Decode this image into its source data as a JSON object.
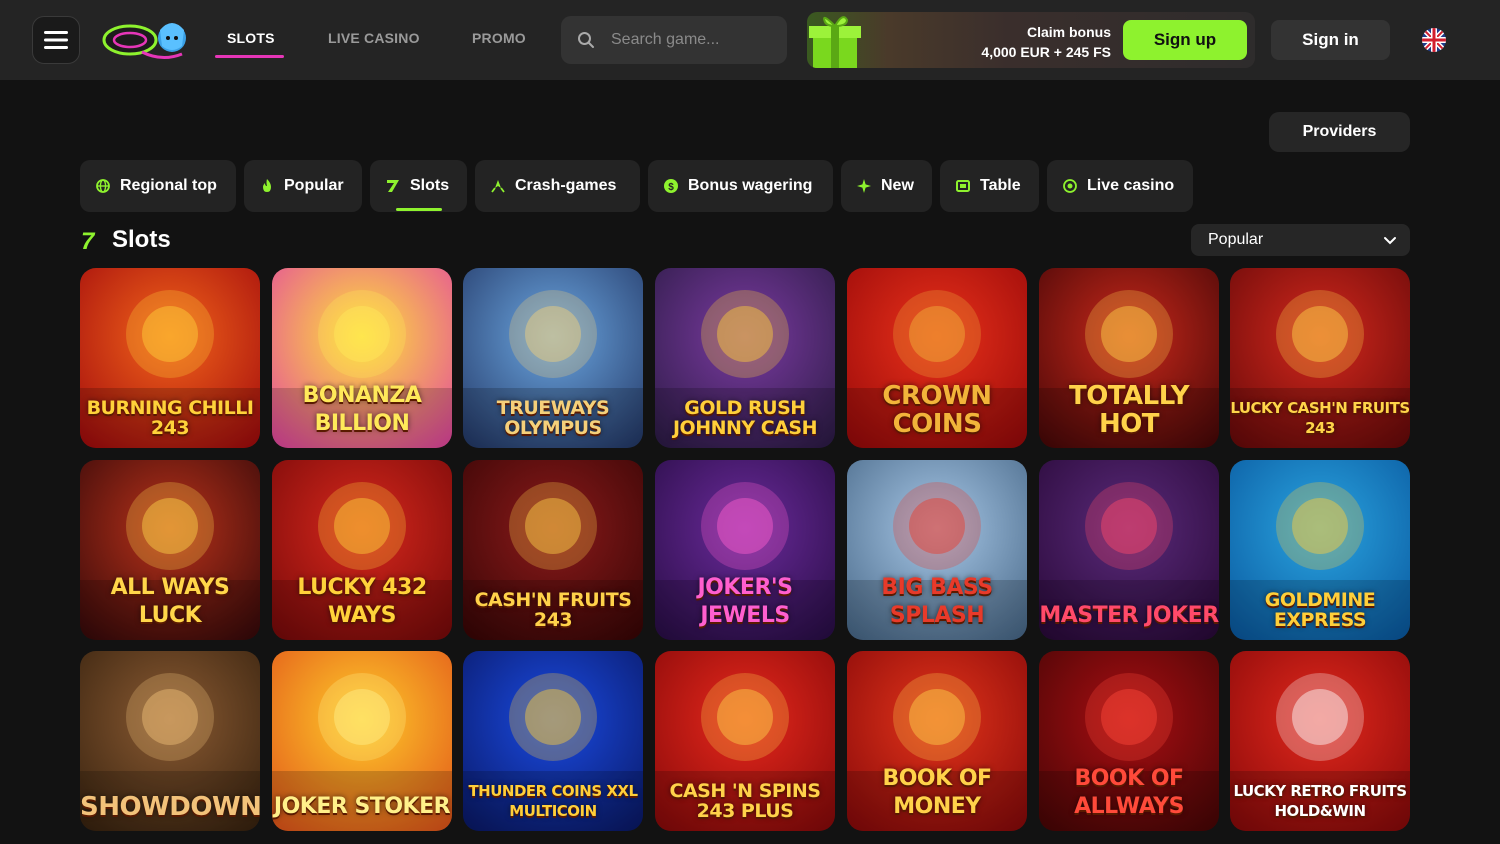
{
  "header": {
    "nav": [
      {
        "label": "SLOTS",
        "active": true
      },
      {
        "label": "LIVE CASINO",
        "active": false
      },
      {
        "label": "PROMO",
        "active": false
      }
    ],
    "search_placeholder": "Search game...",
    "promo": {
      "line1": "Claim bonus",
      "line2": "4,000 EUR + 245 FS"
    },
    "signup_label": "Sign up",
    "signin_label": "Sign in",
    "language": "EN"
  },
  "providers_label": "Providers",
  "categories": [
    {
      "label": "Regional top",
      "icon": "globe-icon"
    },
    {
      "label": "Popular",
      "icon": "flame-icon"
    },
    {
      "label": "Slots",
      "icon": "seven-icon",
      "active": true
    },
    {
      "label": "Crash-games",
      "icon": "crash-icon"
    },
    {
      "label": "Bonus wagering",
      "icon": "dollar-icon"
    },
    {
      "label": "New",
      "icon": "sparkle-icon"
    },
    {
      "label": "Table",
      "icon": "table-icon"
    },
    {
      "label": "Live casino",
      "icon": "live-icon"
    }
  ],
  "section": {
    "icon": "7",
    "title": "Slots",
    "sort_value": "Popular"
  },
  "games": [
    {
      "title": "BURNING CHILLI 243",
      "bg1": "#f2641a",
      "bg2": "#a40d0d",
      "fg": "#ffd23a"
    },
    {
      "title": "BONANZA BILLION",
      "bg1": "#ffe23a",
      "bg2": "#e34b9d",
      "fg": "#ffe95a"
    },
    {
      "title": "TRUEWAYS OLYMPUS",
      "bg1": "#6ba6e0",
      "bg2": "#253b6a",
      "fg": "#f5d07a"
    },
    {
      "title": "GOLD RUSH JOHNNY CASH",
      "bg1": "#7a3aa0",
      "bg2": "#2e1c48",
      "fg": "#ffcf3a"
    },
    {
      "title": "CROWN COINS",
      "bg1": "#e9311a",
      "bg2": "#9a0a0a",
      "fg": "#f2b43a"
    },
    {
      "title": "TOTALLY HOT",
      "bg1": "#c8281a",
      "bg2": "#4a0808",
      "fg": "#ffd24a"
    },
    {
      "title": "LUCKY CASH'N FRUITS 243",
      "bg1": "#d2281c",
      "bg2": "#6a0a0a",
      "fg": "#ffd54a"
    },
    {
      "title": "ALL WAYS LUCK",
      "bg1": "#b8321a",
      "bg2": "#3a0a0a",
      "fg": "#ffd64a"
    },
    {
      "title": "LUCKY 432 WAYS",
      "bg1": "#d6281c",
      "bg2": "#7a0a0a",
      "fg": "#ffd23a"
    },
    {
      "title": "CASH'N FRUITS 243",
      "bg1": "#8a1a1a",
      "bg2": "#3a0606",
      "fg": "#ffd24a"
    },
    {
      "title": "JOKER'S JEWELS",
      "bg1": "#6a2a9a",
      "bg2": "#2a0e48",
      "fg": "#ff5fcf"
    },
    {
      "title": "BIG BASS SPLASH",
      "bg1": "#a7c7e6",
      "bg2": "#4a6a8a",
      "fg": "#e83a2a"
    },
    {
      "title": "MASTER JOKER",
      "bg1": "#5a2a7a",
      "bg2": "#2a0a3a",
      "fg": "#ff4a6a"
    },
    {
      "title": "GOLDMINE EXPRESS",
      "bg1": "#2aa4e0",
      "bg2": "#0a5aa0",
      "fg": "#ffcf3a"
    },
    {
      "title": "SHOWDOWN",
      "bg1": "#8a5a32",
      "bg2": "#3a2410",
      "fg": "#f2c27a"
    },
    {
      "title": "JOKER STOKER",
      "bg1": "#ffcb2a",
      "bg2": "#e2581a",
      "fg": "#fff08a"
    },
    {
      "title": "THUNDER COINS XXL MULTICOIN",
      "bg1": "#1a4ae0",
      "bg2": "#0a1a6a",
      "fg": "#ffcf3a"
    },
    {
      "title": "CASH 'N SPINS 243 PLUS",
      "bg1": "#e6281c",
      "bg2": "#8a0a0a",
      "fg": "#ffd24a"
    },
    {
      "title": "BOOK OF MONEY",
      "bg1": "#e2341a",
      "bg2": "#8a0a0a",
      "fg": "#ffd24a"
    },
    {
      "title": "BOOK OF ALLWAYS",
      "bg1": "#a80e12",
      "bg2": "#4a0606",
      "fg": "#ff4a3a"
    },
    {
      "title": "LUCKY RETRO FRUITS HOLD&WIN",
      "bg1": "#e2281c",
      "bg2": "#8a0a0a",
      "fg": "#ffffff"
    }
  ]
}
